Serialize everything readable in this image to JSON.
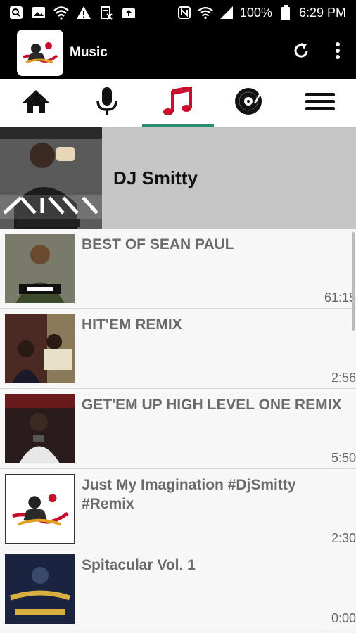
{
  "status_bar": {
    "battery": "100%",
    "time": "6:29 PM"
  },
  "app_bar": {
    "title": "Music"
  },
  "header": {
    "title": "DJ Smitty"
  },
  "tracks": [
    {
      "title": "BEST OF SEAN PAUL",
      "duration": "61:15"
    },
    {
      "title": "HIT'EM REMIX",
      "duration": "2:56"
    },
    {
      "title": "GET'EM UP HIGH LEVEL ONE REMIX",
      "duration": "5:50"
    },
    {
      "title": "Just My Imagination #DjSmitty #Remix",
      "duration": "2:30"
    },
    {
      "title": "Spitacular Vol. 1",
      "duration": "0:00"
    }
  ],
  "colors": {
    "accent": "#2f8a73",
    "active_tab_icon": "#c8102e"
  }
}
